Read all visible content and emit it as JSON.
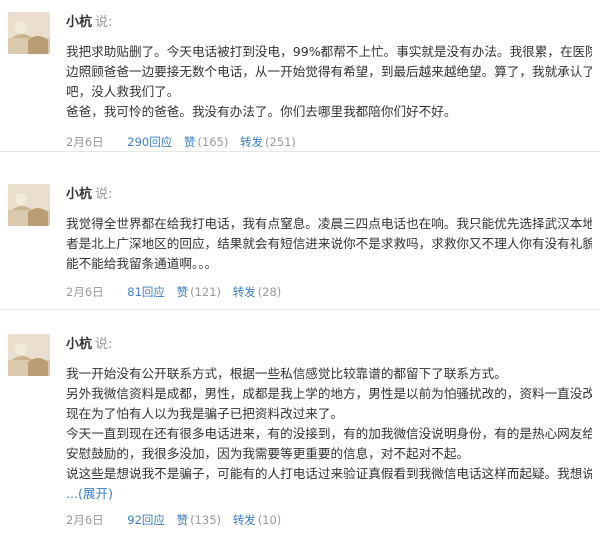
{
  "posts": [
    {
      "author": "小杭",
      "said": "说:",
      "lines": [
        "我把求助贴删了。今天电话被打到没电，99%都帮不上忙。事实就是没有办法。我很累，在医院一",
        "边照顾爸爸一边要接无数个电话，从一开始觉得有希望，到最后越来越绝望。算了，我就承认了",
        "吧，没人救我们了。",
        "爸爸，我可怜的爸爸。我没有办法了。你们去哪里我都陪你们好不好。"
      ],
      "date": "2月6日",
      "replies": "290回应",
      "like_label": "赞",
      "like_count": "(165)",
      "repost_label": "转发",
      "repost_count": "(251)"
    },
    {
      "author": "小杭",
      "said": "说:",
      "lines": [
        "我觉得全世界都在给我打电话，我有点窒息。凌晨三四点电话也在响。我只能优先选择武汉本地或",
        "者是北上广深地区的回应，结果就会有短信进来说你不是求救吗，求救你又不理人你有没有礼貌。",
        "能不能给我留条通道啊。。。"
      ],
      "date": "2月6日",
      "replies": "81回应",
      "like_label": "赞",
      "like_count": "(121)",
      "repost_label": "转发",
      "repost_count": "(28)"
    },
    {
      "author": "小杭",
      "said": "说:",
      "lines": [
        "我一开始没有公开联系方式，根据一些私信感觉比较靠谱的都留下了联系方式。",
        "另外我微信资料是成都，男性，成都是我上学的地方，男性是以前为怕骚扰改的，资料一直没改。",
        "现在为了怕有人以为我是骗子已把资料改过来了。",
        "今天一直到现在还有很多电话进来，有的没接到，有的加我微信没说明身份，有的是热心网友给我",
        "安慰鼓励的，我很多没加，因为我需要等更重要的信息，对不起对不起。",
        "说这些是想说我不是骗子，可能有的人打电话过来验证真假看到我微信电话这样而起疑。我想说明"
      ],
      "expand": "...(展开)",
      "date": "2月6日",
      "replies": "92回应",
      "like_label": "赞",
      "like_count": "(135)",
      "repost_label": "转发",
      "repost_count": "(10)"
    }
  ]
}
